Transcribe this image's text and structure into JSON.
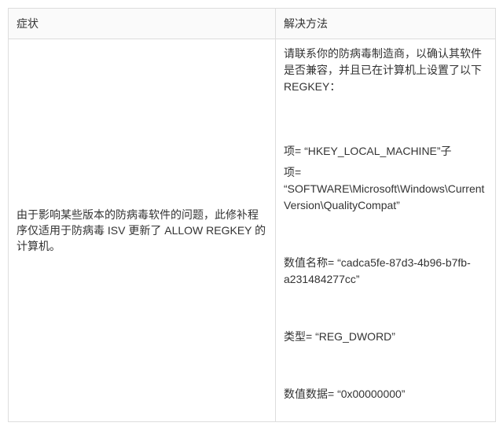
{
  "headers": {
    "symptom": "症状",
    "solution": "解决方法"
  },
  "row": {
    "symptom": "由于影响某些版本的防病毒软件的问题，此修补程序仅适用于防病毒 ISV 更新了 ALLOW REGKEY 的计算机。",
    "solution": {
      "line1": "请联系你的防病毒制造商，以确认其软件是否兼容，并且已在计算机上设置了以下 REGKEY：",
      "line2": "项= “HKEY_LOCAL_MACHINE”子",
      "line3": "项= “SOFTWARE\\Microsoft\\Windows\\CurrentVersion\\QualityCompat”",
      "line4": "数值名称= “cadca5fe-87d3-4b96-b7fb-a231484277cc”",
      "line5": "类型= “REG_DWORD”",
      "line6": "数值数据= “0x00000000”"
    }
  }
}
